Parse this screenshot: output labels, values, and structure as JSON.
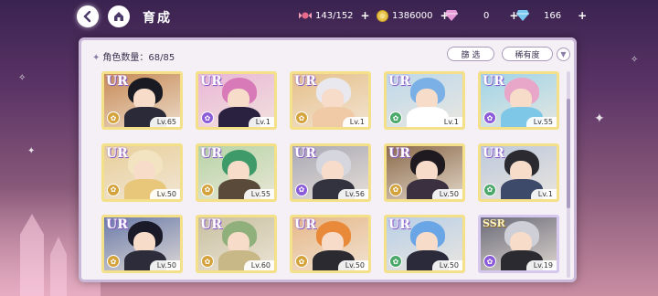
{
  "topbar": {
    "title": "育成",
    "resources": [
      {
        "icon": "candy-icon",
        "value": "143/152",
        "color": "#e86a8a"
      },
      {
        "icon": "coin-icon",
        "value": "1386000",
        "color": "#e6c34a"
      },
      {
        "icon": "pink-gem-icon",
        "value": "0",
        "color": "#e69ad8"
      },
      {
        "icon": "blue-gem-icon",
        "value": "166",
        "color": "#7ac9f0"
      }
    ],
    "plus": "+"
  },
  "panel": {
    "count_label": "角色数量：68/85",
    "filter_label": "篩 选",
    "rarity_label": "稀有度"
  },
  "cards": [
    {
      "rarity": "UR",
      "level": "Lv.65",
      "attr_color": "#d4a23a",
      "hair": "#1a1a22",
      "outfit": "#2a2a38",
      "bg": "#c78a56"
    },
    {
      "rarity": "UR",
      "level": "Lv.1",
      "attr_color": "#8b5ad9",
      "hair": "#d97ab8",
      "outfit": "#2a2040",
      "bg": "#e9b6d6"
    },
    {
      "rarity": "UR",
      "level": "Lv.1",
      "attr_color": "#d4a23a",
      "hair": "#e8e8ee",
      "outfit": "#f0c9a6",
      "bg": "#e6c08a"
    },
    {
      "rarity": "UR",
      "level": "Lv.1",
      "attr_color": "#4aa86a",
      "hair": "#7ab0e6",
      "outfit": "#ffffff",
      "bg": "#bcd8ea"
    },
    {
      "rarity": "UR",
      "level": "Lv.55",
      "attr_color": "#8b5ad9",
      "hair": "#e8a7c9",
      "outfit": "#7ec7e6",
      "bg": "#9fd4e8"
    },
    {
      "rarity": "UR",
      "level": "Lv.50",
      "attr_color": "#d4a23a",
      "hair": "#f2e4c0",
      "outfit": "#e8c67a",
      "bg": "#e8cf9a"
    },
    {
      "rarity": "UR",
      "level": "Lv.55",
      "attr_color": "#d4a23a",
      "hair": "#3f9a6a",
      "outfit": "#5a4a3a",
      "bg": "#b6d4a6"
    },
    {
      "rarity": "UR",
      "level": "Lv.56",
      "attr_color": "#8b5ad9",
      "hair": "#d6d6de",
      "outfit": "#333340",
      "bg": "#a8a8b4"
    },
    {
      "rarity": "UR",
      "level": "Lv.50",
      "attr_color": "#d4a23a",
      "hair": "#1e1a20",
      "outfit": "#3a3040",
      "bg": "#8a6a4a"
    },
    {
      "rarity": "UR",
      "level": "Lv.1",
      "attr_color": "#4aa86a",
      "hair": "#2a2a30",
      "outfit": "#3e4a6a",
      "bg": "#bcc9dc"
    },
    {
      "rarity": "UR",
      "level": "Lv.50",
      "attr_color": "#d4a23a",
      "hair": "#1a1a28",
      "outfit": "#2c2c3a",
      "bg": "#6a7aa8"
    },
    {
      "rarity": "UR",
      "level": "Lv.60",
      "attr_color": "#d4a23a",
      "hair": "#8fb07a",
      "outfit": "#c8b888",
      "bg": "#c8c0a0"
    },
    {
      "rarity": "UR",
      "level": "Lv.50",
      "attr_color": "#d4a23a",
      "hair": "#e88a3a",
      "outfit": "#2a2a30",
      "bg": "#e6b88a"
    },
    {
      "rarity": "UR",
      "level": "Lv.50",
      "attr_color": "#4aa86a",
      "hair": "#6aa6e6",
      "outfit": "#2a2a3a",
      "bg": "#b8cfe6"
    },
    {
      "rarity": "SSR",
      "level": "Lv.19",
      "attr_color": "#8b5ad9",
      "hair": "#cfcfd8",
      "outfit": "#2a2a30",
      "bg": "#6a6a78"
    }
  ]
}
